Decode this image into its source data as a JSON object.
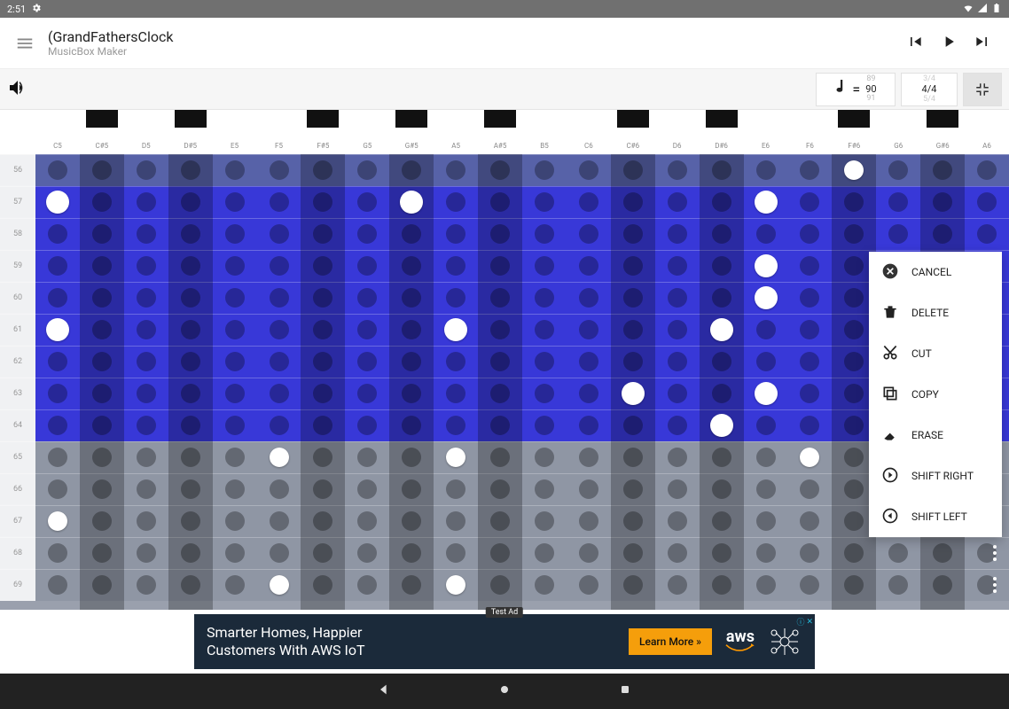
{
  "status_bar": {
    "time": "2:51"
  },
  "toolbar": {
    "title": "(GrandFathersClock",
    "subtitle": "MusicBox Maker"
  },
  "tempo": {
    "prev": "89",
    "value": "90",
    "next": "91",
    "equals": "="
  },
  "time_sig": {
    "prev": "3/4",
    "value": "4/4",
    "next": "5/4"
  },
  "note_labels": [
    "C5",
    "C#5",
    "D5",
    "D#5",
    "E5",
    "F5",
    "F#5",
    "G5",
    "G#5",
    "A5",
    "A#5",
    "B5",
    "C6",
    "C#6",
    "D6",
    "D#6",
    "E6",
    "F6",
    "F#6",
    "G6",
    "G#6",
    "A6"
  ],
  "rows": [
    "56",
    "57",
    "58",
    "59",
    "60",
    "61",
    "62",
    "63",
    "64",
    "65",
    "66",
    "67",
    "68",
    "69"
  ],
  "selection": {
    "start": 57,
    "end": 64
  },
  "context_menu": [
    {
      "key": "cancel",
      "label": "CANCEL",
      "icon": "close"
    },
    {
      "key": "delete",
      "label": "DELETE",
      "icon": "trash"
    },
    {
      "key": "cut",
      "label": "CUT",
      "icon": "cut"
    },
    {
      "key": "copy",
      "label": "COPY",
      "icon": "copy"
    },
    {
      "key": "erase",
      "label": "ERASE",
      "icon": "erase"
    },
    {
      "key": "shift_right",
      "label": "SHIFT RIGHT",
      "icon": "arrow-right"
    },
    {
      "key": "shift_left",
      "label": "SHIFT LEFT",
      "icon": "arrow-left"
    }
  ],
  "notes": [
    {
      "row": 56,
      "col": 18
    },
    {
      "row": 57,
      "col": 0
    },
    {
      "row": 57,
      "col": 8
    },
    {
      "row": 57,
      "col": 16
    },
    {
      "row": 59,
      "col": 16
    },
    {
      "row": 60,
      "col": 16
    },
    {
      "row": 61,
      "col": 0
    },
    {
      "row": 61,
      "col": 9
    },
    {
      "row": 61,
      "col": 15
    },
    {
      "row": 63,
      "col": 13
    },
    {
      "row": 63,
      "col": 16
    },
    {
      "row": 64,
      "col": 15
    },
    {
      "row": 65,
      "col": 5
    },
    {
      "row": 65,
      "col": 9
    },
    {
      "row": 65,
      "col": 17
    },
    {
      "row": 67,
      "col": 0
    },
    {
      "row": 69,
      "col": 5
    },
    {
      "row": 69,
      "col": 9
    }
  ],
  "ad": {
    "label": "Test Ad",
    "text1": "Smarter Homes, Happier",
    "text2": "Customers With AWS IoT",
    "cta": "Learn More »",
    "brand": "aws"
  }
}
